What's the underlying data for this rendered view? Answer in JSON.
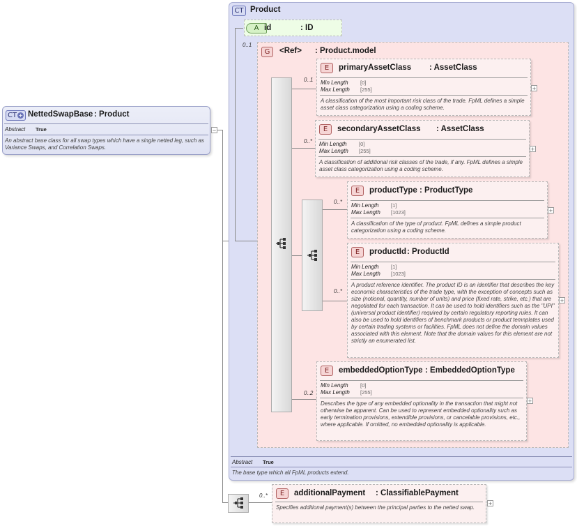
{
  "netted": {
    "badge": "CT",
    "name": "NettedSwapBase",
    "type": ": Product",
    "abstract_label": "Abstract",
    "abstract_value": "True",
    "doc": "An abstract base class for all swap types which have a single netted leg, such as Variance Swaps, and Correlation Swaps."
  },
  "product": {
    "badge": "CT",
    "name": "Product",
    "abstract_label": "Abstract",
    "abstract_value": "True",
    "doc": "The base type which all FpML products extend."
  },
  "attr": {
    "badge": "A",
    "name": "id",
    "type": ": ID"
  },
  "group": {
    "badge": "G",
    "name": "<Ref>",
    "type": ": Product.model",
    "occurrence": "0..1"
  },
  "elements": {
    "primary": {
      "badge": "E",
      "name": "primaryAssetClass",
      "type": ": AssetClass",
      "occurrence": "0..1",
      "min_label": "Min Length",
      "min_value": "[0]",
      "max_label": "Max Length",
      "max_value": "[255]",
      "doc": "A classification of the most important risk class of the trade. FpML defines a simple asset class categorization using a coding scheme."
    },
    "secondary": {
      "badge": "E",
      "name": "secondaryAssetClass",
      "type": ": AssetClass",
      "occurrence": "0..*",
      "min_label": "Min Length",
      "min_value": "[0]",
      "max_label": "Max Length",
      "max_value": "[255]",
      "doc": "A classification of additional risk classes of the trade, if any. FpML defines a simple asset class categorization using a coding scheme."
    },
    "productType": {
      "badge": "E",
      "name": "productType",
      "type": ": ProductType",
      "occurrence": "0..*",
      "min_label": "Min Length",
      "min_value": "[1]",
      "max_label": "Max Length",
      "max_value": "[1023]",
      "doc": "A classification of the type of product. FpML defines a simple product categorization using a coding scheme."
    },
    "productId": {
      "badge": "E",
      "name": "productId",
      "type": ": ProductId",
      "occurrence": "0..*",
      "min_label": "Min Length",
      "min_value": "[1]",
      "max_label": "Max Length",
      "max_value": "[1023]",
      "doc": "A product reference identifier. The product ID is an identifier that describes the key economic characteristics of the trade type, with the exception of concepts such as size (notional, quantity, number of units) and price (fixed rate, strike, etc.) that are negotiated for each transaction. It can be used to hold identifiers such as the \"UPI\" (universal product identifier) required by certain regulatory reporting rules. It can also be used to hold identifiers of benchmark products or product temnplates used by certain trading systems or facilities. FpML does not define the domain values associated with this element. Note that the domain values for this element are not strictly an enumerated list."
    },
    "embedded": {
      "badge": "E",
      "name": "embeddedOptionType",
      "type": ": EmbeddedOptionType",
      "occurrence": "0..2",
      "min_label": "Min Length",
      "min_value": "[0]",
      "max_label": "Max Length",
      "max_value": "[255]",
      "doc": "Describes the type of any embedded optionality in the transaction that might not otherwise be apparent. Can be used to represent embedded optionality such as early termination provisions, extendible provisions, or cancelable provisions, etc., where applicable. If omitted, no embedded optionality is applicable."
    },
    "additional": {
      "badge": "E",
      "name": "additionalPayment",
      "type": ": ClassifiablePayment",
      "occurrence": "0..*",
      "doc": "Specifies additional payment(s) between the principal parties to the netted swap."
    }
  },
  "symbols": {
    "plus": "+",
    "minus": "−"
  },
  "colors": {
    "ct_fill": "#dcdff5",
    "group_fill": "#fde4e4",
    "element_fill": "#fcf0f0"
  }
}
